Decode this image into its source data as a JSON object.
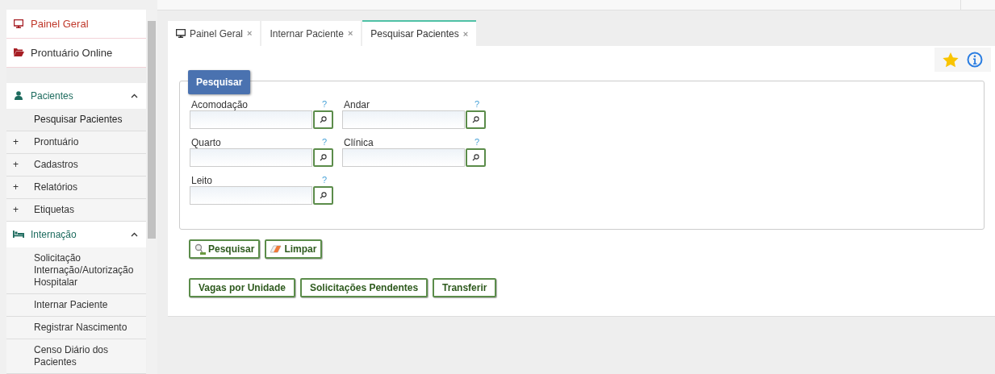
{
  "sidebar": {
    "items": [
      {
        "kind": "top",
        "label": "Painel Geral",
        "selected": true
      },
      {
        "kind": "top",
        "label": "Prontuário Online",
        "selected": false
      },
      {
        "kind": "spacer"
      },
      {
        "kind": "section",
        "label": "Pacientes",
        "expanded": true,
        "children": [
          {
            "label": "Pesquisar Pacientes",
            "selected": true
          },
          {
            "toggle": "+",
            "label": "Prontuário",
            "selected": false
          },
          {
            "toggle": "+",
            "label": "Cadastros",
            "selected": false
          },
          {
            "toggle": "+",
            "label": "Relatórios",
            "selected": false
          },
          {
            "toggle": "+",
            "label": "Etiquetas",
            "selected": false
          }
        ]
      },
      {
        "kind": "section",
        "label": "Internação",
        "expanded": true,
        "children": [
          {
            "label": "Solicitação Internação/Autorização Hospitalar",
            "selected": false
          },
          {
            "label": "Internar Paciente",
            "selected": false
          },
          {
            "label": "Registrar Nascimento",
            "selected": false
          },
          {
            "label": "Censo Diário dos Pacientes",
            "selected": false
          }
        ]
      }
    ]
  },
  "tabs": [
    {
      "label": "Painel Geral",
      "close": "×",
      "selected": false
    },
    {
      "label": "Internar Paciente",
      "close": "×",
      "selected": false
    },
    {
      "label": "Pesquisar Pacientes",
      "close": "×",
      "selected": true
    }
  ],
  "form": {
    "legend": "Pesquisar",
    "fields": [
      {
        "label": "Acomodação",
        "help": "?"
      },
      {
        "label": "Andar",
        "help": "?"
      },
      {
        "label": "Quarto",
        "help": "?"
      },
      {
        "label": "Clínica",
        "help": "?"
      },
      {
        "label": "Leito",
        "help": "?"
      }
    ]
  },
  "actions": [
    {
      "label": "Pesquisar"
    },
    {
      "label": "Limpar"
    }
  ],
  "links": [
    "Vagas por Unidade",
    "Solicitações Pendentes",
    "Transferir"
  ]
}
